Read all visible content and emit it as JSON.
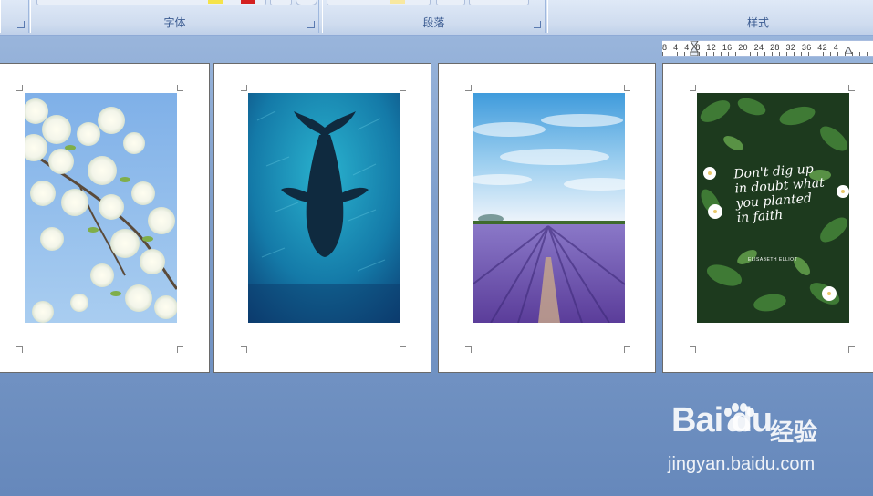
{
  "ribbon": {
    "groups": [
      {
        "label": "字体"
      },
      {
        "label": "段落"
      },
      {
        "label": "样式"
      }
    ]
  },
  "ruler": {
    "text": "8 4 4 8 12 16 20 24 28 32 36 42 4"
  },
  "pages": [
    {
      "image": "white-blossoms-photo"
    },
    {
      "image": "underwater-whale-photo"
    },
    {
      "image": "lavender-field-photo"
    },
    {
      "image": "green-leaves-lettering-photo",
      "lettering": "Don't dig up in doubt what you planted in faith",
      "author": "ELISABETH ELLIOT"
    }
  ],
  "watermark": {
    "brand": "Bai du",
    "cn": "经验",
    "url": "jingyan.baidu.com"
  }
}
